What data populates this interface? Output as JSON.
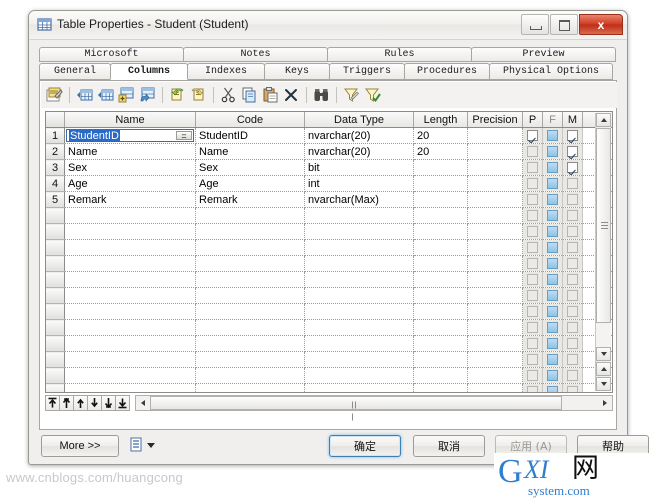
{
  "window": {
    "title": "Table Properties - Student (Student)",
    "icon": "table-icon",
    "minimize_label": "Minimize",
    "maximize_label": "Maximize",
    "close_label": "x"
  },
  "tabs": {
    "row1": [
      {
        "label": "Microsoft",
        "active": false
      },
      {
        "label": "Notes",
        "active": false
      },
      {
        "label": "Rules",
        "active": false
      },
      {
        "label": "Preview",
        "active": false
      }
    ],
    "row2": [
      {
        "label": "General",
        "active": false
      },
      {
        "label": "Columns",
        "active": true
      },
      {
        "label": "Indexes",
        "active": false
      },
      {
        "label": "Keys",
        "active": false
      },
      {
        "label": "Triggers",
        "active": false
      },
      {
        "label": "Procedures",
        "active": false
      },
      {
        "label": "Physical Options",
        "active": false
      }
    ]
  },
  "toolbar": {
    "buttons": [
      {
        "name": "properties-icon",
        "glyph": "▤"
      },
      {
        "name": "insert-row-icon",
        "glyph": "▦"
      },
      {
        "name": "add-row-icon",
        "glyph": "▦"
      },
      {
        "name": "add-column-icon",
        "glyph": "▦"
      },
      {
        "name": "duplicate-row-icon",
        "glyph": "▦"
      },
      {
        "name": "undo-icon",
        "glyph": "↶"
      },
      {
        "name": "redo-icon",
        "glyph": "↷"
      },
      {
        "name": "cut-icon",
        "glyph": "✂"
      },
      {
        "name": "copy-icon",
        "glyph": "❐"
      },
      {
        "name": "paste-icon",
        "glyph": "ὌB"
      },
      {
        "name": "delete-icon",
        "glyph": "✕"
      },
      {
        "name": "find-icon",
        "glyph": "⬚"
      },
      {
        "name": "filter-icon",
        "glyph": "▽"
      },
      {
        "name": "apply-filter-icon",
        "glyph": "▽"
      }
    ]
  },
  "grid": {
    "headers": [
      "Name",
      "Code",
      "Data Type",
      "Length",
      "Precision",
      "P",
      "F",
      "M"
    ],
    "rows": [
      {
        "num": "1",
        "name": "StudentID",
        "code": "StudentID",
        "datatype": "nvarchar(20)",
        "length": "20",
        "precision": "",
        "p": true,
        "f": "blue",
        "m": true,
        "selected": true,
        "eq": "="
      },
      {
        "num": "2",
        "name": "Name",
        "code": "Name",
        "datatype": "nvarchar(20)",
        "length": "20",
        "precision": "",
        "p": false,
        "f": "blue",
        "m": true,
        "selected": false
      },
      {
        "num": "3",
        "name": "Sex",
        "code": "Sex",
        "datatype": "bit",
        "length": "",
        "precision": "",
        "p": false,
        "f": "blue",
        "m": true,
        "selected": false
      },
      {
        "num": "4",
        "name": "Age",
        "code": "Age",
        "datatype": "int",
        "length": "",
        "precision": "",
        "p": false,
        "f": "blue",
        "m": false,
        "selected": false
      },
      {
        "num": "5",
        "name": "Remark",
        "code": "Remark",
        "datatype": "nvarchar(Max)",
        "length": "",
        "precision": "",
        "p": false,
        "f": "blue",
        "m": false,
        "selected": false
      }
    ],
    "empty_row_count": 16
  },
  "gridfoot": {
    "nav_buttons": [
      {
        "name": "move-to-top-button",
        "glyph": "⤒"
      },
      {
        "name": "move-up-button",
        "glyph": "↑"
      },
      {
        "name": "move-up-one-button",
        "glyph": "↑"
      },
      {
        "name": "move-down-one-button",
        "glyph": "↓"
      },
      {
        "name": "move-down-button",
        "glyph": "↓"
      },
      {
        "name": "move-to-bottom-button",
        "glyph": "⤓"
      }
    ]
  },
  "footer": {
    "more_label": "More >>",
    "menu_icon": "list-menu-icon",
    "ok_label": "确定",
    "cancel_label": "取消",
    "apply_label": "应用 (A)",
    "help_label": "帮助"
  },
  "watermark": {
    "text": "www.cnblogs.com/huangcong"
  },
  "logo": {
    "g": "G",
    "xi": "XI",
    "net": "网",
    "domain": "system.com",
    "color": "#2f7fd0"
  }
}
